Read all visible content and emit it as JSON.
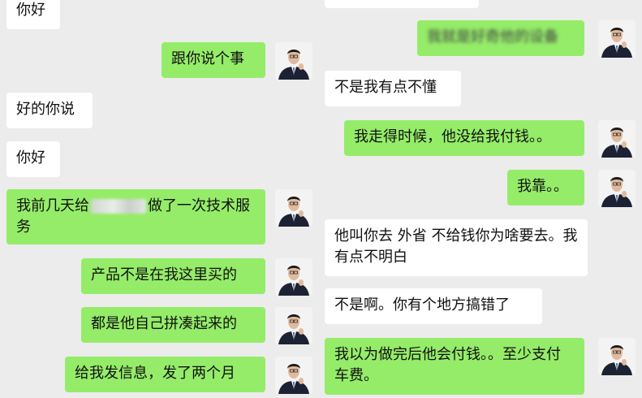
{
  "left_column": {
    "messages": [
      {
        "side": "incoming",
        "text": "你好"
      },
      {
        "side": "outgoing",
        "text": "跟你说个事"
      },
      {
        "side": "incoming",
        "text": "好的你说"
      },
      {
        "side": "incoming",
        "text": "你好"
      },
      {
        "side": "outgoing",
        "text_before": "我前几天给",
        "text_after": "做了一次技术服务"
      },
      {
        "side": "outgoing",
        "text": "产品不是在我这里买的"
      },
      {
        "side": "outgoing",
        "text": "都是他自己拼凑起来的"
      },
      {
        "side": "outgoing",
        "text": "给我发信息，发了两个月"
      }
    ]
  },
  "right_column": {
    "messages": [
      {
        "side": "outgoing",
        "text": "我就是好奇他的设备"
      },
      {
        "side": "incoming",
        "text": "不是我有点不懂"
      },
      {
        "side": "outgoing",
        "text": "我走得时候，他没给我付钱。。"
      },
      {
        "side": "outgoing",
        "text": "我靠。。"
      },
      {
        "side": "incoming",
        "text": "他叫你去 外省 不给钱你为啥要去。我有点不明白"
      },
      {
        "side": "incoming",
        "text": "不是啊。你有个地方搞错了"
      },
      {
        "side": "outgoing",
        "text": "我以为做完后他会付钱。。至少支付车费。"
      }
    ]
  },
  "colors": {
    "background": "#ececec",
    "incoming_bubble": "#ffffff",
    "outgoing_bubble": "#95ec69",
    "text": "#111111"
  },
  "icons": {
    "avatar": "user-avatar-icon"
  }
}
